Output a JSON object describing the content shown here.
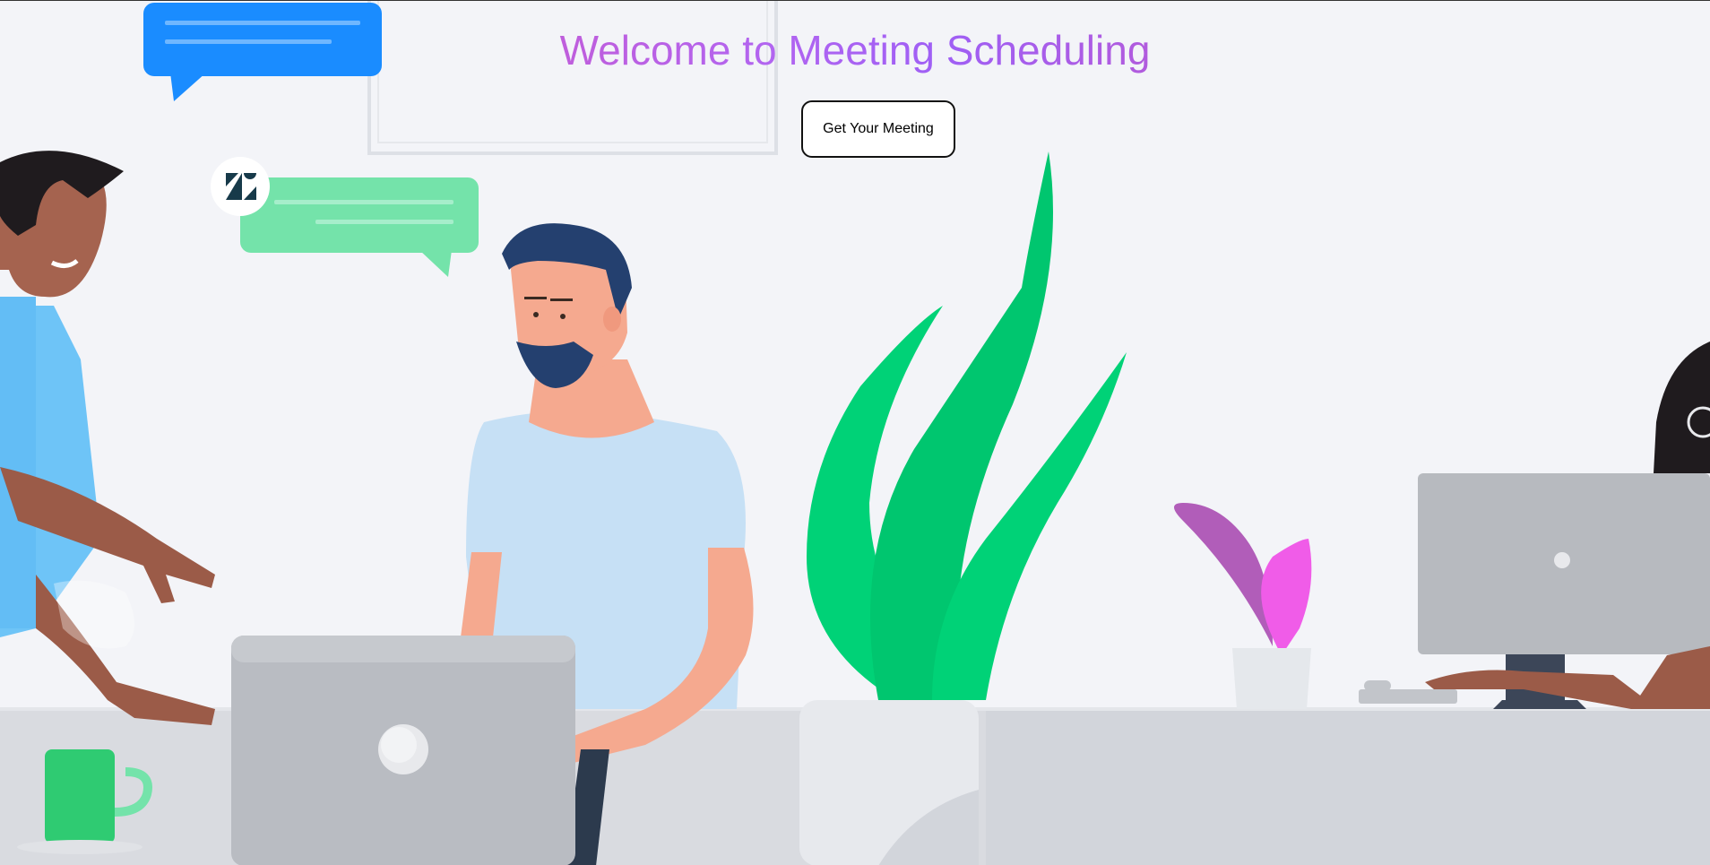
{
  "page": {
    "title": "Welcome to Meeting Scheduling",
    "cta_label": "Get Your Meeting"
  },
  "illustration": {
    "logo_icon": "zendesk-logo-icon",
    "colors": {
      "background": "#f3f4f8",
      "chat_bubble_blue": "#1a8cff",
      "chat_bubble_green": "#74e3aa",
      "plant_green": "#00d277",
      "plant_pink": "#f05ce8",
      "plant_purple": "#b15db9",
      "shirt_blue": "#c6e0f5",
      "laptop_grey": "#b9bcc2",
      "desk_grey": "#d9dbe0",
      "mug_green": "#2fcb72"
    }
  }
}
